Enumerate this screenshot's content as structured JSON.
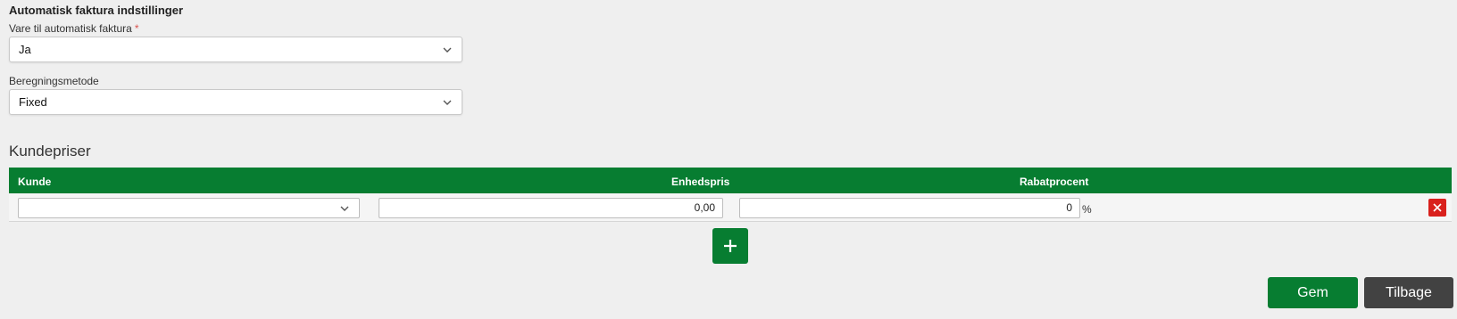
{
  "auto_invoice": {
    "section_title": "Automatisk faktura indstillinger",
    "item_label": "Vare til automatisk faktura",
    "required_mark": "*",
    "item_value": "Ja",
    "method_label": "Beregningsmetode",
    "method_value": "Fixed"
  },
  "customer_prices": {
    "title": "Kundepriser",
    "columns": {
      "customer": "Kunde",
      "unit_price": "Enhedspris",
      "discount": "Rabatprocent"
    },
    "rows": [
      {
        "customer": "",
        "unit_price": "0,00",
        "discount": "0",
        "discount_unit": "%"
      }
    ]
  },
  "actions": {
    "add_symbol": "+",
    "save_label": "Gem",
    "back_label": "Tilbage"
  },
  "colors": {
    "primary_green": "#077d31",
    "danger_red": "#d9211d",
    "dark_button": "#424242"
  },
  "icons": {
    "dropdown": "chevron-down-icon",
    "delete": "close-icon",
    "add": "plus-icon"
  }
}
